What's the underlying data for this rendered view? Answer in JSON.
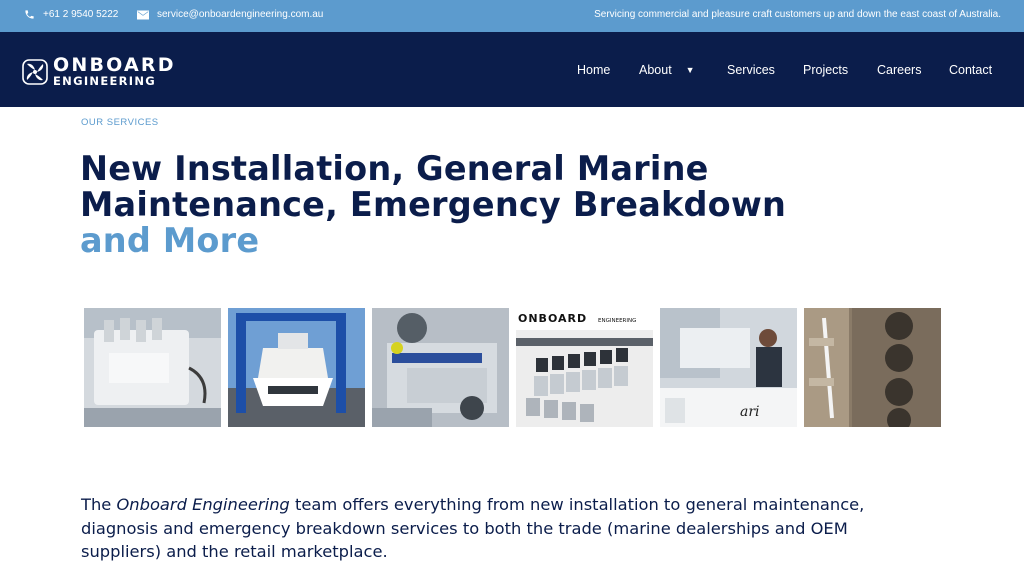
{
  "topbar": {
    "phone": "+61 2 9540 5222",
    "email": "service@onboardengineering.com.au",
    "tagline": "Servicing commercial and pleasure craft customers up and down the east coast of Australia."
  },
  "brand": {
    "line1": "ONBOARD",
    "line2": "ENGINEERING"
  },
  "nav": {
    "items": [
      {
        "label": "Home"
      },
      {
        "label": "About"
      },
      {
        "label": "Services"
      },
      {
        "label": "Projects"
      },
      {
        "label": "Careers"
      },
      {
        "label": "Contact"
      }
    ]
  },
  "hero": {
    "eyebrow": "OUR SERVICES",
    "title_line1": "New Installation, General Marine",
    "title_line2": "Maintenance, Emergency Breakdown",
    "title_accent": "and More"
  },
  "gallery": {
    "photo4_brand": "ONBOARD",
    "photo4_subbrand": "ENGINEERING"
  },
  "intro": {
    "text_before": "The ",
    "company": "Onboard Engineering",
    "text_after": " team offers everything from new installation to general maintenance, diagnosis and emergency breakdown services to both the trade (marine dealerships and OEM suppliers) and the retail marketplace."
  },
  "colors": {
    "navy": "#0b1d4b",
    "accent": "#5c9bce",
    "white": "#ffffff"
  },
  "icons": {
    "phone": "phone-icon",
    "email": "envelope-icon",
    "caret": "caret-down-icon",
    "logo": "propeller-logo-icon"
  }
}
